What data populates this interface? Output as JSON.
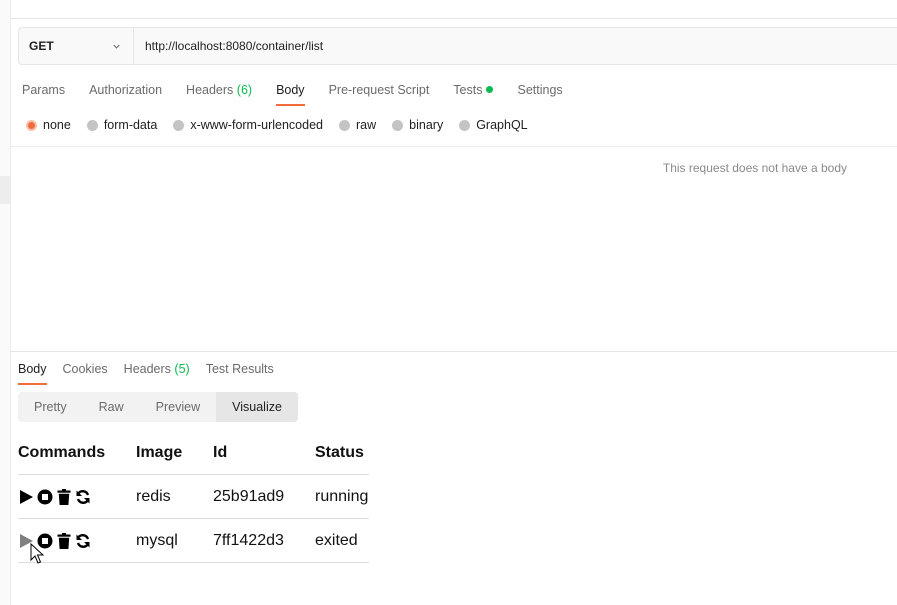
{
  "request": {
    "method": "GET",
    "url": "http://localhost:8080/container/list",
    "tabs": [
      {
        "label": "Params"
      },
      {
        "label": "Authorization"
      },
      {
        "label": "Headers",
        "count": "(6)"
      },
      {
        "label": "Body"
      },
      {
        "label": "Pre-request Script"
      },
      {
        "label": "Tests"
      },
      {
        "label": "Settings"
      }
    ],
    "active_tab": "Body",
    "body_types": [
      "none",
      "form-data",
      "x-www-form-urlencoded",
      "raw",
      "binary",
      "GraphQL"
    ],
    "selected_body_type": "none",
    "no_body_text": "This request does not have a body"
  },
  "response": {
    "tabs": [
      {
        "label": "Body"
      },
      {
        "label": "Cookies"
      },
      {
        "label": "Headers",
        "count": "(5)"
      },
      {
        "label": "Test Results"
      }
    ],
    "active_tab": "Body",
    "view_modes": [
      "Pretty",
      "Raw",
      "Preview",
      "Visualize"
    ],
    "active_view_mode": "Visualize",
    "table": {
      "headers": [
        "Commands",
        "Image",
        "Id",
        "Status"
      ],
      "rows": [
        {
          "image": "redis",
          "id": "25b91ad9",
          "status": "running"
        },
        {
          "image": "mysql",
          "id": "7ff1422d3",
          "status": "exited"
        }
      ],
      "command_icons": [
        "play-icon",
        "stop-icon",
        "trash-icon",
        "restart-icon"
      ]
    }
  },
  "colors": {
    "accent": "#f26b3a",
    "success": "#0cbb52"
  }
}
